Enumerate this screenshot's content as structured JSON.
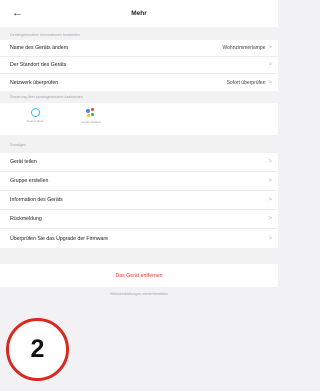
{
  "header": {
    "back_icon": "←",
    "title": "Mehr"
  },
  "device_section": {
    "label": "Gerätegebundene Informationen bearbeiten",
    "items": [
      {
        "label": "Name des Geräts ändern",
        "value": "Wohnzimmerlampe",
        "chevron": ">"
      },
      {
        "label": "Der Standort des Geräts",
        "value": "",
        "chevron": ">"
      },
      {
        "label": "Netzwerk überprüfen",
        "value": "Sofort überprüfen",
        "chevron": ">"
      }
    ]
  },
  "assistants_section": {
    "label": "Steuerung über sprachgesteuerte Assistenten",
    "items": [
      {
        "icon": "alexa-icon",
        "caption": "Amazon Alexa"
      },
      {
        "icon": "google-assistant-icon",
        "caption": "Google Assistant"
      }
    ]
  },
  "general_section": {
    "label": "Sonstiges",
    "items": [
      {
        "label": "Gerät teilen",
        "chevron": ">"
      },
      {
        "label": "Gruppe erstellen",
        "chevron": ">"
      },
      {
        "label": "Information des Geräts",
        "chevron": ">"
      },
      {
        "label": "Rückmeldung",
        "chevron": ">"
      },
      {
        "label": "Überprüfen Sie das Upgrade der Firmware",
        "chevron": ">"
      }
    ]
  },
  "remove_button": {
    "label": "Das Gerät entfernen"
  },
  "reset_link": {
    "label": "Werkseinstellungen wiederherstellen"
  },
  "annotation": {
    "number": "2"
  },
  "colors": {
    "danger": "#e23a2e",
    "alexa": "#31c4f3",
    "badge_border": "#d7291f"
  }
}
